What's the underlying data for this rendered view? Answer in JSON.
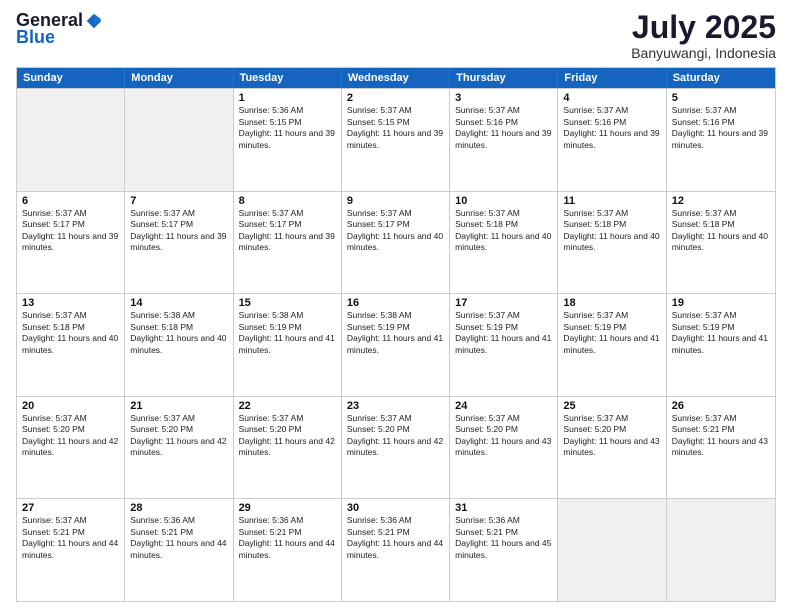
{
  "logo": {
    "general": "General",
    "blue": "Blue"
  },
  "title": "July 2025",
  "location": "Banyuwangi, Indonesia",
  "weekdays": [
    "Sunday",
    "Monday",
    "Tuesday",
    "Wednesday",
    "Thursday",
    "Friday",
    "Saturday"
  ],
  "weeks": [
    [
      {
        "day": "",
        "empty": true
      },
      {
        "day": "",
        "empty": true
      },
      {
        "day": "1",
        "sunrise": "Sunrise: 5:36 AM",
        "sunset": "Sunset: 5:15 PM",
        "daylight": "Daylight: 11 hours and 39 minutes."
      },
      {
        "day": "2",
        "sunrise": "Sunrise: 5:37 AM",
        "sunset": "Sunset: 5:15 PM",
        "daylight": "Daylight: 11 hours and 39 minutes."
      },
      {
        "day": "3",
        "sunrise": "Sunrise: 5:37 AM",
        "sunset": "Sunset: 5:16 PM",
        "daylight": "Daylight: 11 hours and 39 minutes."
      },
      {
        "day": "4",
        "sunrise": "Sunrise: 5:37 AM",
        "sunset": "Sunset: 5:16 PM",
        "daylight": "Daylight: 11 hours and 39 minutes."
      },
      {
        "day": "5",
        "sunrise": "Sunrise: 5:37 AM",
        "sunset": "Sunset: 5:16 PM",
        "daylight": "Daylight: 11 hours and 39 minutes."
      }
    ],
    [
      {
        "day": "6",
        "sunrise": "Sunrise: 5:37 AM",
        "sunset": "Sunset: 5:17 PM",
        "daylight": "Daylight: 11 hours and 39 minutes."
      },
      {
        "day": "7",
        "sunrise": "Sunrise: 5:37 AM",
        "sunset": "Sunset: 5:17 PM",
        "daylight": "Daylight: 11 hours and 39 minutes."
      },
      {
        "day": "8",
        "sunrise": "Sunrise: 5:37 AM",
        "sunset": "Sunset: 5:17 PM",
        "daylight": "Daylight: 11 hours and 39 minutes."
      },
      {
        "day": "9",
        "sunrise": "Sunrise: 5:37 AM",
        "sunset": "Sunset: 5:17 PM",
        "daylight": "Daylight: 11 hours and 40 minutes."
      },
      {
        "day": "10",
        "sunrise": "Sunrise: 5:37 AM",
        "sunset": "Sunset: 5:18 PM",
        "daylight": "Daylight: 11 hours and 40 minutes."
      },
      {
        "day": "11",
        "sunrise": "Sunrise: 5:37 AM",
        "sunset": "Sunset: 5:18 PM",
        "daylight": "Daylight: 11 hours and 40 minutes."
      },
      {
        "day": "12",
        "sunrise": "Sunrise: 5:37 AM",
        "sunset": "Sunset: 5:18 PM",
        "daylight": "Daylight: 11 hours and 40 minutes."
      }
    ],
    [
      {
        "day": "13",
        "sunrise": "Sunrise: 5:37 AM",
        "sunset": "Sunset: 5:18 PM",
        "daylight": "Daylight: 11 hours and 40 minutes."
      },
      {
        "day": "14",
        "sunrise": "Sunrise: 5:38 AM",
        "sunset": "Sunset: 5:18 PM",
        "daylight": "Daylight: 11 hours and 40 minutes."
      },
      {
        "day": "15",
        "sunrise": "Sunrise: 5:38 AM",
        "sunset": "Sunset: 5:19 PM",
        "daylight": "Daylight: 11 hours and 41 minutes."
      },
      {
        "day": "16",
        "sunrise": "Sunrise: 5:38 AM",
        "sunset": "Sunset: 5:19 PM",
        "daylight": "Daylight: 11 hours and 41 minutes."
      },
      {
        "day": "17",
        "sunrise": "Sunrise: 5:37 AM",
        "sunset": "Sunset: 5:19 PM",
        "daylight": "Daylight: 11 hours and 41 minutes."
      },
      {
        "day": "18",
        "sunrise": "Sunrise: 5:37 AM",
        "sunset": "Sunset: 5:19 PM",
        "daylight": "Daylight: 11 hours and 41 minutes."
      },
      {
        "day": "19",
        "sunrise": "Sunrise: 5:37 AM",
        "sunset": "Sunset: 5:19 PM",
        "daylight": "Daylight: 11 hours and 41 minutes."
      }
    ],
    [
      {
        "day": "20",
        "sunrise": "Sunrise: 5:37 AM",
        "sunset": "Sunset: 5:20 PM",
        "daylight": "Daylight: 11 hours and 42 minutes."
      },
      {
        "day": "21",
        "sunrise": "Sunrise: 5:37 AM",
        "sunset": "Sunset: 5:20 PM",
        "daylight": "Daylight: 11 hours and 42 minutes."
      },
      {
        "day": "22",
        "sunrise": "Sunrise: 5:37 AM",
        "sunset": "Sunset: 5:20 PM",
        "daylight": "Daylight: 11 hours and 42 minutes."
      },
      {
        "day": "23",
        "sunrise": "Sunrise: 5:37 AM",
        "sunset": "Sunset: 5:20 PM",
        "daylight": "Daylight: 11 hours and 42 minutes."
      },
      {
        "day": "24",
        "sunrise": "Sunrise: 5:37 AM",
        "sunset": "Sunset: 5:20 PM",
        "daylight": "Daylight: 11 hours and 43 minutes."
      },
      {
        "day": "25",
        "sunrise": "Sunrise: 5:37 AM",
        "sunset": "Sunset: 5:20 PM",
        "daylight": "Daylight: 11 hours and 43 minutes."
      },
      {
        "day": "26",
        "sunrise": "Sunrise: 5:37 AM",
        "sunset": "Sunset: 5:21 PM",
        "daylight": "Daylight: 11 hours and 43 minutes."
      }
    ],
    [
      {
        "day": "27",
        "sunrise": "Sunrise: 5:37 AM",
        "sunset": "Sunset: 5:21 PM",
        "daylight": "Daylight: 11 hours and 44 minutes."
      },
      {
        "day": "28",
        "sunrise": "Sunrise: 5:36 AM",
        "sunset": "Sunset: 5:21 PM",
        "daylight": "Daylight: 11 hours and 44 minutes."
      },
      {
        "day": "29",
        "sunrise": "Sunrise: 5:36 AM",
        "sunset": "Sunset: 5:21 PM",
        "daylight": "Daylight: 11 hours and 44 minutes."
      },
      {
        "day": "30",
        "sunrise": "Sunrise: 5:36 AM",
        "sunset": "Sunset: 5:21 PM",
        "daylight": "Daylight: 11 hours and 44 minutes."
      },
      {
        "day": "31",
        "sunrise": "Sunrise: 5:36 AM",
        "sunset": "Sunset: 5:21 PM",
        "daylight": "Daylight: 11 hours and 45 minutes."
      },
      {
        "day": "",
        "empty": true
      },
      {
        "day": "",
        "empty": true
      }
    ]
  ]
}
